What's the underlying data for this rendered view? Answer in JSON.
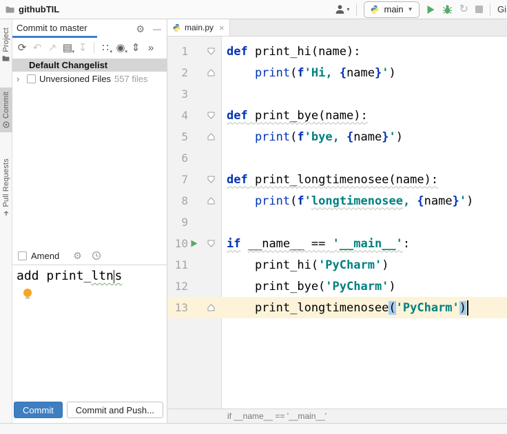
{
  "titlebar": {
    "project": "githubTIL",
    "run_config": "main",
    "git_label": "Gi"
  },
  "tool_stripe": {
    "items": [
      {
        "label": "Project"
      },
      {
        "label": "Commit",
        "active": true
      },
      {
        "label": "Pull Requests"
      }
    ]
  },
  "icons": {
    "gear": "⚙",
    "minimize": "—",
    "dropdown": "▾",
    "combo_arrow": "▼",
    "rerun": "↻",
    "tab_close": "×",
    "tree_chevron": "›"
  },
  "commit_panel": {
    "title": "Commit to master",
    "toolbar": [
      {
        "name": "refresh-icon",
        "glyph": "⟳",
        "enabled": true,
        "dropdown": false
      },
      {
        "name": "rollback-icon",
        "glyph": "↶",
        "enabled": false,
        "dropdown": false
      },
      {
        "name": "revert-icon",
        "glyph": "↗",
        "enabled": false,
        "dropdown": false
      },
      {
        "name": "changelist-icon",
        "glyph": "▤",
        "enabled": true,
        "dropdown": true
      },
      {
        "name": "shelve-icon",
        "glyph": "↧",
        "enabled": false,
        "dropdown": false
      },
      {
        "sep": true
      },
      {
        "name": "group-by-icon",
        "glyph": "∷",
        "enabled": true,
        "dropdown": true
      },
      {
        "name": "show-options-icon",
        "glyph": "◉",
        "enabled": true,
        "dropdown": true
      },
      {
        "name": "expand-collapse-icon",
        "glyph": "⇕",
        "enabled": true,
        "dropdown": false
      },
      {
        "name": "more-icon",
        "glyph": "»",
        "enabled": true,
        "dropdown": false
      }
    ],
    "changelist": "Default Changelist",
    "unversioned": {
      "label": "Unversioned Files",
      "count": "557 files"
    },
    "amend_label": "Amend",
    "message": {
      "value": "add print_ltns",
      "prefix": "add print_",
      "typo_before_caret": "ltn",
      "after_caret": "s"
    },
    "buttons": {
      "commit": "Commit",
      "commit_and_push": "Commit and Push..."
    }
  },
  "editor": {
    "tab": "main.py",
    "breadcrumb": "if __name__ == '__main__'",
    "lines": [
      {
        "n": "1",
        "fold": "start",
        "tokens": [
          [
            "def",
            "kw"
          ],
          [
            " print_hi(name):",
            "pl"
          ]
        ]
      },
      {
        "n": "2",
        "fold": "end",
        "tokens": [
          [
            "    print",
            "fn"
          ],
          [
            "(",
            "pl"
          ],
          [
            "f",
            "kw"
          ],
          [
            "'Hi, ",
            "str"
          ],
          [
            "{",
            "kw"
          ],
          [
            "name",
            "pl"
          ],
          [
            "}",
            "kw"
          ],
          [
            "'",
            "str"
          ],
          [
            ")",
            "pl"
          ]
        ]
      },
      {
        "n": "3",
        "tokens": []
      },
      {
        "n": "4",
        "fold": "start",
        "tokens": [
          [
            "def",
            "kw sq"
          ],
          [
            " print_bye(name):",
            "pl sq"
          ]
        ]
      },
      {
        "n": "5",
        "fold": "end",
        "tokens": [
          [
            "    print",
            "fn"
          ],
          [
            "(",
            "pl"
          ],
          [
            "f",
            "kw"
          ],
          [
            "'bye, ",
            "str"
          ],
          [
            "{",
            "kw"
          ],
          [
            "name",
            "pl"
          ],
          [
            "}",
            "kw"
          ],
          [
            "'",
            "str"
          ],
          [
            ")",
            "pl"
          ]
        ]
      },
      {
        "n": "6",
        "tokens": []
      },
      {
        "n": "7",
        "fold": "start",
        "tokens": [
          [
            "def",
            "kw sq"
          ],
          [
            " print_longtimenosee(name):",
            "pl sq"
          ]
        ]
      },
      {
        "n": "8",
        "fold": "end",
        "tokens": [
          [
            "    print",
            "fn"
          ],
          [
            "(",
            "pl"
          ],
          [
            "f",
            "kw"
          ],
          [
            "'",
            "str"
          ],
          [
            "longtimenosee",
            "str sq"
          ],
          [
            ", ",
            "str"
          ],
          [
            "{",
            "kw"
          ],
          [
            "name",
            "pl"
          ],
          [
            "}",
            "kw"
          ],
          [
            "'",
            "str"
          ],
          [
            ")",
            "pl"
          ]
        ]
      },
      {
        "n": "9",
        "tokens": []
      },
      {
        "n": "10",
        "fold": "start",
        "run": true,
        "tokens": [
          [
            "if",
            "kw sq"
          ],
          [
            " ",
            "pl"
          ],
          [
            "__name__ == ",
            "pl sq"
          ],
          [
            "'__main__'",
            "str sq"
          ],
          [
            ":",
            "pl"
          ]
        ]
      },
      {
        "n": "11",
        "tokens": [
          [
            "    print_hi(",
            "pl"
          ],
          [
            "'PyCharm'",
            "str"
          ],
          [
            ")",
            "pl"
          ]
        ]
      },
      {
        "n": "12",
        "tokens": [
          [
            "    print_bye(",
            "pl"
          ],
          [
            "'PyCharm'",
            "str"
          ],
          [
            ")",
            "pl"
          ]
        ]
      },
      {
        "n": "13",
        "fold": "end",
        "current": true,
        "caret": true,
        "tokens": [
          [
            "    print_longtimenosee",
            "pl"
          ],
          [
            "(",
            "pl hl"
          ],
          [
            "'PyCharm'",
            "str"
          ],
          [
            ")",
            "pl hl"
          ]
        ]
      }
    ]
  },
  "colors": {
    "accent_blue": "#3c7fd5",
    "commit_button_blue": "#3e7ec1",
    "keyword_blue": "#0033b3",
    "string_teal": "#008080",
    "current_line_bg": "#fcf3d9",
    "brace_match_bg": "#a6cdf2",
    "run_green": "#59a869",
    "selection_gray": "#d5d5d5"
  }
}
